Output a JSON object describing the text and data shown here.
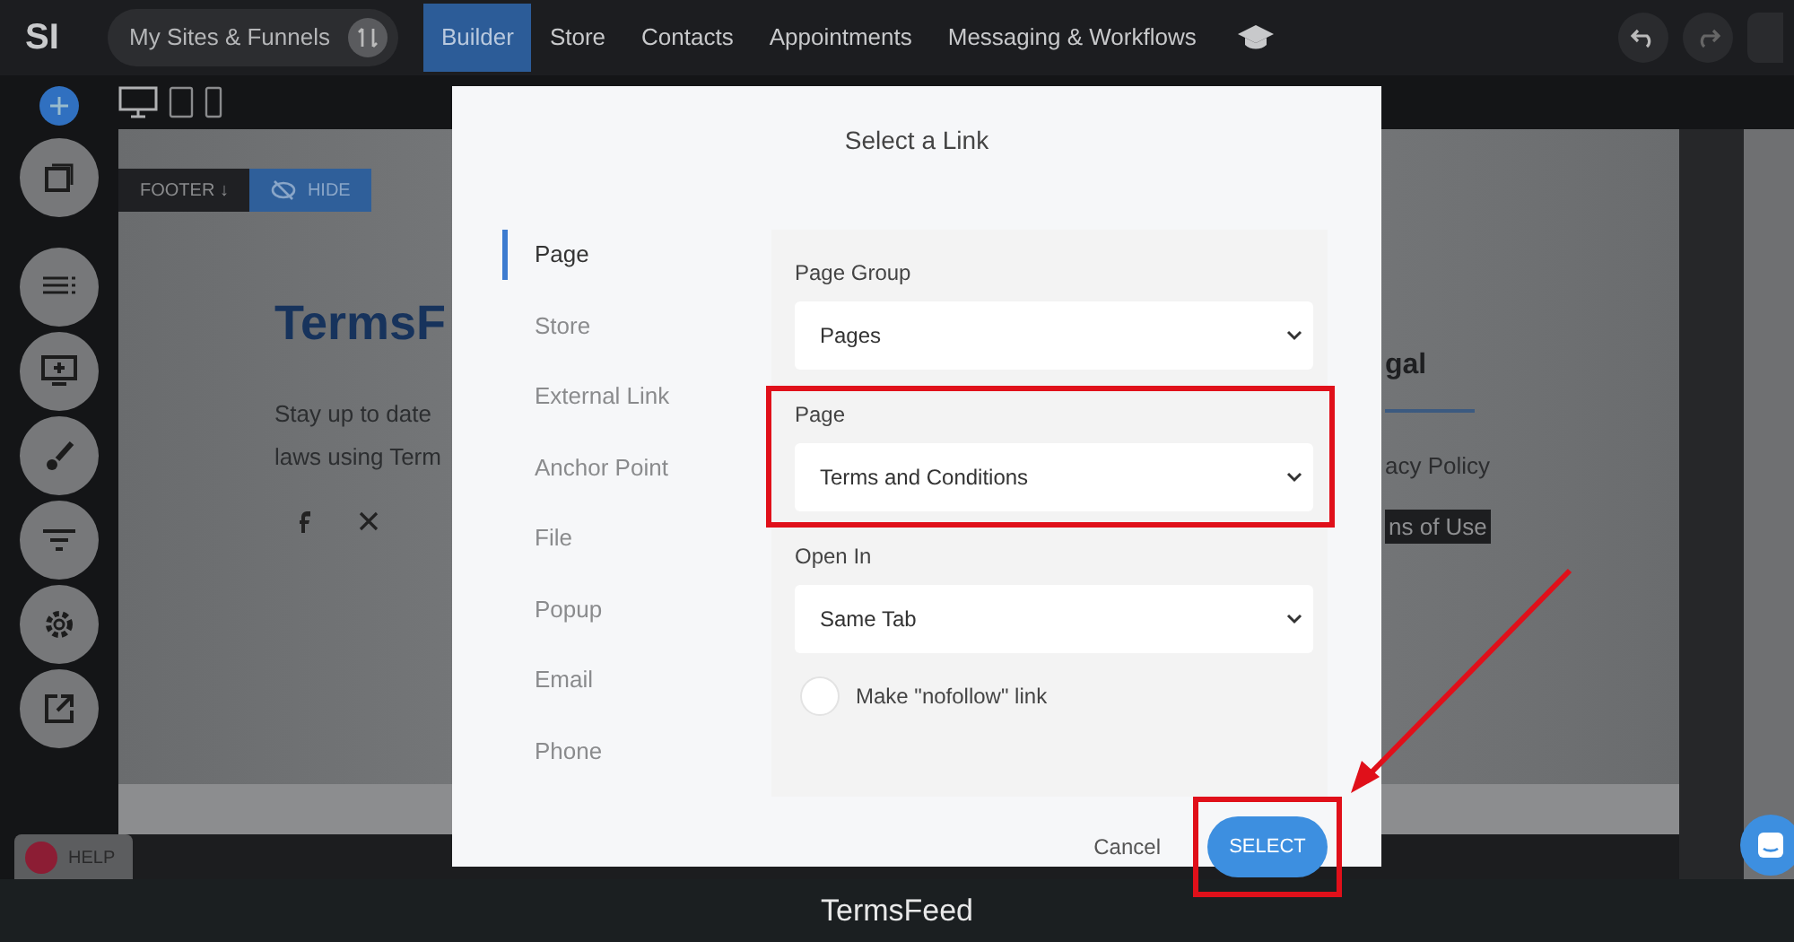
{
  "top_nav": {
    "logo": "SI",
    "site_switcher": "My Sites & Funnels",
    "tabs": [
      {
        "label": "Builder",
        "selected": true
      },
      {
        "label": "Store",
        "selected": false
      },
      {
        "label": "Contacts",
        "selected": false
      },
      {
        "label": "Appointments",
        "selected": false
      },
      {
        "label": "Messaging & Workflows",
        "selected": false
      }
    ]
  },
  "canvas": {
    "section_tag": "FOOTER ↓",
    "hide_button": "HIDE",
    "brand_heading": "TermsF",
    "description_lines": [
      "Stay up to date",
      "laws using Term"
    ],
    "legal_heading": "gal",
    "legal_links": [
      {
        "label": "acy Policy",
        "highlighted": false
      },
      {
        "label": "ns of Use",
        "highlighted": true
      }
    ]
  },
  "help_button": "HELP",
  "modal": {
    "title": "Select a Link",
    "menu": [
      {
        "label": "Page",
        "selected": true
      },
      {
        "label": "Store",
        "selected": false
      },
      {
        "label": "External Link",
        "selected": false
      },
      {
        "label": "Anchor Point",
        "selected": false
      },
      {
        "label": "File",
        "selected": false
      },
      {
        "label": "Popup",
        "selected": false
      },
      {
        "label": "Email",
        "selected": false
      },
      {
        "label": "Phone",
        "selected": false
      }
    ],
    "fields": [
      {
        "label": "Page Group",
        "value": "Pages",
        "highlighted": false
      },
      {
        "label": "Page",
        "value": "Terms and Conditions",
        "highlighted": true
      },
      {
        "label": "Open In",
        "value": "Same Tab",
        "highlighted": false
      }
    ],
    "nofollow": {
      "label": "Make \"nofollow\" link",
      "checked": false
    },
    "cancel": "Cancel",
    "select": {
      "label": "SELECT",
      "highlighted": true
    }
  },
  "caption": "TermsFeed"
}
